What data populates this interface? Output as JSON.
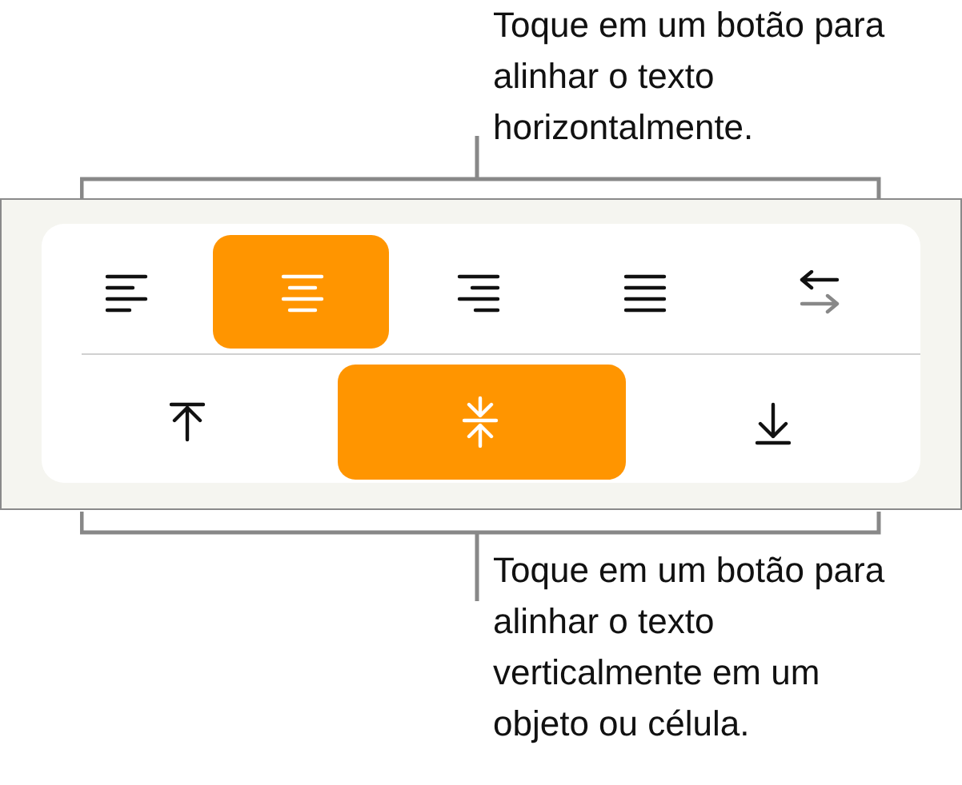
{
  "callouts": [
    {
      "text": "Toque em um botão para alinhar o texto horizontalmente."
    },
    {
      "text": "Toque em um botão para alinhar o texto verticalmente em um objeto ou célula."
    }
  ],
  "horizontal_buttons": [
    {
      "kind": "left",
      "selected": false
    },
    {
      "kind": "center",
      "selected": true
    },
    {
      "kind": "right",
      "selected": false
    },
    {
      "kind": "justify",
      "selected": false
    },
    {
      "kind": "direction",
      "selected": false
    }
  ],
  "vertical_buttons": [
    {
      "kind": "top",
      "selected": false
    },
    {
      "kind": "middle",
      "selected": true
    },
    {
      "kind": "bottom",
      "selected": false
    }
  ]
}
